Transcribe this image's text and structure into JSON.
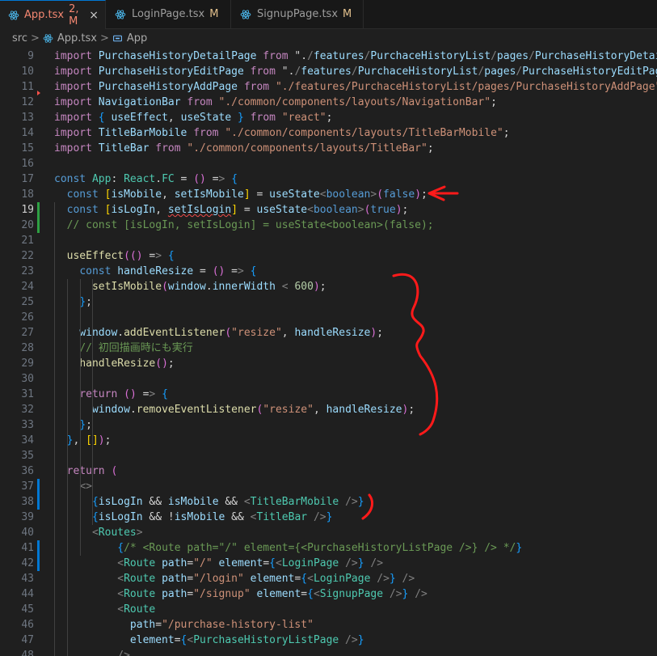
{
  "tabs": [
    {
      "name": "App.tsx",
      "badge": "2, M",
      "status": "error",
      "active": true,
      "close": "×"
    },
    {
      "name": "LoginPage.tsx",
      "badge": "M",
      "status": "modified",
      "active": false
    },
    {
      "name": "SignupPage.tsx",
      "badge": "M",
      "status": "modified",
      "active": false
    }
  ],
  "breadcrumb": {
    "folder": "src",
    "file": "App.tsx",
    "symbol": "App",
    "separator": ">"
  },
  "editor": {
    "current_line": 19,
    "lines": [
      {
        "n": "9",
        "text": "import PurchaseHistoryDetailPage from \"./features/PurchaceHistoryList/pages/PurchaseHistoryDetail"
      },
      {
        "n": "10",
        "text": "import PurchaseHistoryEditPage from \"./features/PurchaceHistoryList/pages/PurchaseHistoryEditPage"
      },
      {
        "n": "11",
        "text": "import PurchaseHistoryAddPage from \"./features/PurchaceHistoryList/pages/PurchaseHistoryAddPage\";"
      },
      {
        "n": "12",
        "text": "import NavigationBar from \"./common/components/layouts/NavigationBar\";"
      },
      {
        "n": "13",
        "text": "import { useEffect, useState } from \"react\";"
      },
      {
        "n": "14",
        "text": "import TitleBarMobile from \"./common/components/layouts/TitleBarMobile\";"
      },
      {
        "n": "15",
        "text": "import TitleBar from \"./common/components/layouts/TitleBar\";"
      },
      {
        "n": "16",
        "text": ""
      },
      {
        "n": "17",
        "text": "const App: React.FC = () => {"
      },
      {
        "n": "18",
        "text": "  const [isMobile, setIsMobile] = useState<boolean>(false);"
      },
      {
        "n": "19",
        "text": "  const [isLogIn, setIsLogin] = useState<boolean>(true);"
      },
      {
        "n": "20",
        "text": "  // const [isLogIn, setIsLogin] = useState<boolean>(false);"
      },
      {
        "n": "21",
        "text": ""
      },
      {
        "n": "22",
        "text": "  useEffect(() => {"
      },
      {
        "n": "23",
        "text": "    const handleResize = () => {"
      },
      {
        "n": "24",
        "text": "      setIsMobile(window.innerWidth < 600);"
      },
      {
        "n": "25",
        "text": "    };"
      },
      {
        "n": "26",
        "text": ""
      },
      {
        "n": "27",
        "text": "    window.addEventListener(\"resize\", handleResize);"
      },
      {
        "n": "28",
        "text": "    // 初回描画時にも実行"
      },
      {
        "n": "29",
        "text": "    handleResize();"
      },
      {
        "n": "30",
        "text": ""
      },
      {
        "n": "31",
        "text": "    return () => {"
      },
      {
        "n": "32",
        "text": "      window.removeEventListener(\"resize\", handleResize);"
      },
      {
        "n": "33",
        "text": "    };"
      },
      {
        "n": "34",
        "text": "  }, []);"
      },
      {
        "n": "35",
        "text": ""
      },
      {
        "n": "36",
        "text": "  return ("
      },
      {
        "n": "37",
        "text": "    <>"
      },
      {
        "n": "38",
        "text": "      {isLogIn && isMobile && <TitleBarMobile />}"
      },
      {
        "n": "39",
        "text": "      {isLogIn && !isMobile && <TitleBar />}"
      },
      {
        "n": "40",
        "text": "      <Routes>"
      },
      {
        "n": "41",
        "text": "          {/* <Route path=\"/\" element={<PurchaseHistoryListPage />} /> */}"
      },
      {
        "n": "42",
        "text": "          <Route path=\"/\" element={<LoginPage />} />"
      },
      {
        "n": "43",
        "text": "          <Route path=\"/login\" element={<LoginPage />} />"
      },
      {
        "n": "44",
        "text": "          <Route path=\"/signup\" element={<SignupPage />} />"
      },
      {
        "n": "45",
        "text": "          <Route"
      },
      {
        "n": "46",
        "text": "            path=\"/purchase-history-list\""
      },
      {
        "n": "47",
        "text": "            element={<PurchaseHistoryListPage />}"
      },
      {
        "n": "48",
        "text": "          />"
      }
    ]
  },
  "colors": {
    "accent": "#0078d4",
    "error": "#f48771",
    "modified": "#e2c08d",
    "annotation": "#ff1a1a"
  }
}
